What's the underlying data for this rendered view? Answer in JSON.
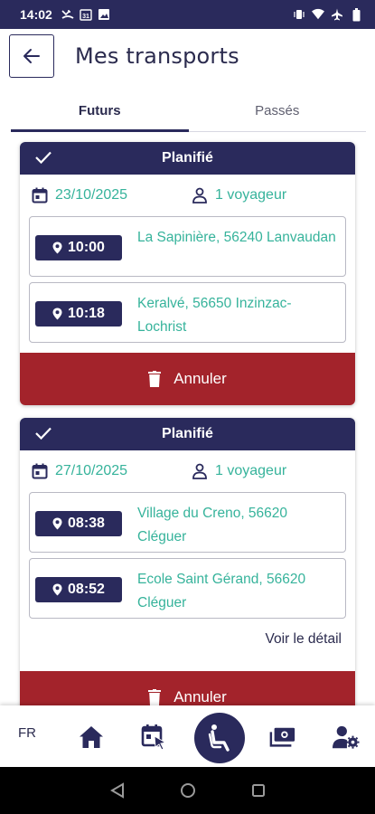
{
  "status_bar": {
    "time": "14:02",
    "icons": [
      "call-missed-icon",
      "calendar-31-icon",
      "image-icon",
      "vibrate-icon",
      "wifi-icon",
      "airplane-icon",
      "battery-icon"
    ],
    "calendar_day": "31"
  },
  "header": {
    "title": "Mes transports"
  },
  "tabs": [
    {
      "label": "Futurs",
      "active": true
    },
    {
      "label": "Passés",
      "active": false
    }
  ],
  "trips": [
    {
      "status": "Planifié",
      "date": "23/10/2025",
      "passengers": "1 voyageur",
      "stops": [
        {
          "time": "10:00",
          "address": "La Sapinière, 56240 Lanvaudan"
        },
        {
          "time": "10:18",
          "address": "Keralvé, 56650 Inzinzac-Lochrist"
        }
      ],
      "detail_link": "",
      "cancel_label": "Annuler"
    },
    {
      "status": "Planifié",
      "date": "27/10/2025",
      "passengers": "1 voyageur",
      "stops": [
        {
          "time": "08:38",
          "address": "Village du Creno, 56620 Cléguer"
        },
        {
          "time": "08:52",
          "address": "Ecole Saint Gérand, 56620 Cléguer"
        }
      ],
      "detail_link": "Voir le détail",
      "cancel_label": "Annuler"
    }
  ],
  "bottom_nav": {
    "language": "FR",
    "items": [
      "home-icon",
      "calendar-booking-icon",
      "wheelchair-icon",
      "ticket-money-icon",
      "user-settings-icon"
    ]
  },
  "colors": {
    "primary": "#2a2a5c",
    "accent": "#36b39b",
    "danger": "#a3232b"
  }
}
